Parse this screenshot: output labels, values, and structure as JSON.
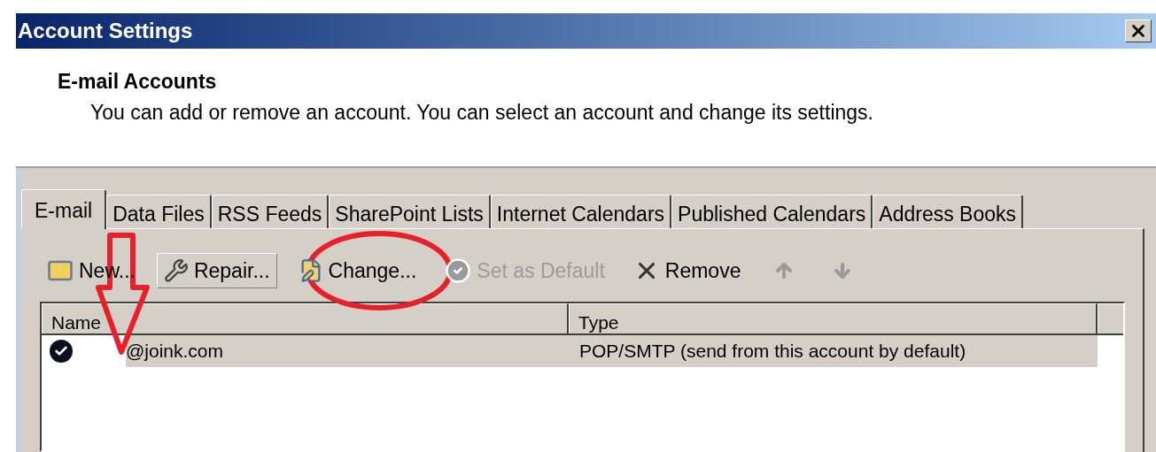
{
  "window": {
    "title": "Account Settings"
  },
  "header": {
    "title": "E-mail Accounts",
    "description": "You can add or remove an account. You can select an account and change its settings."
  },
  "tabs": [
    {
      "label": "E-mail",
      "selected": true
    },
    {
      "label": "Data Files",
      "selected": false
    },
    {
      "label": "RSS Feeds",
      "selected": false
    },
    {
      "label": "SharePoint Lists",
      "selected": false
    },
    {
      "label": "Internet Calendars",
      "selected": false
    },
    {
      "label": "Published Calendars",
      "selected": false
    },
    {
      "label": "Address Books",
      "selected": false
    }
  ],
  "toolbar": [
    {
      "kind": "new",
      "label": "New...",
      "disabled": false,
      "raised": false
    },
    {
      "kind": "repair",
      "label": "Repair...",
      "disabled": false,
      "raised": true
    },
    {
      "kind": "change",
      "label": "Change...",
      "disabled": false,
      "raised": false
    },
    {
      "kind": "default",
      "label": "Set as Default",
      "disabled": true,
      "raised": false
    },
    {
      "kind": "remove",
      "label": "Remove",
      "disabled": false,
      "raised": false
    },
    {
      "kind": "up",
      "disabled": true,
      "raised": false
    },
    {
      "kind": "down",
      "disabled": true,
      "raised": false
    }
  ],
  "list": {
    "columns": [
      "Name",
      "Type"
    ],
    "rows": [
      {
        "name": "@joink.com",
        "type": "POP/SMTP (send from this account by default)",
        "selected": true,
        "default": true,
        "redacted": true
      }
    ]
  },
  "annotations": {
    "arrow": true,
    "circle": true
  }
}
